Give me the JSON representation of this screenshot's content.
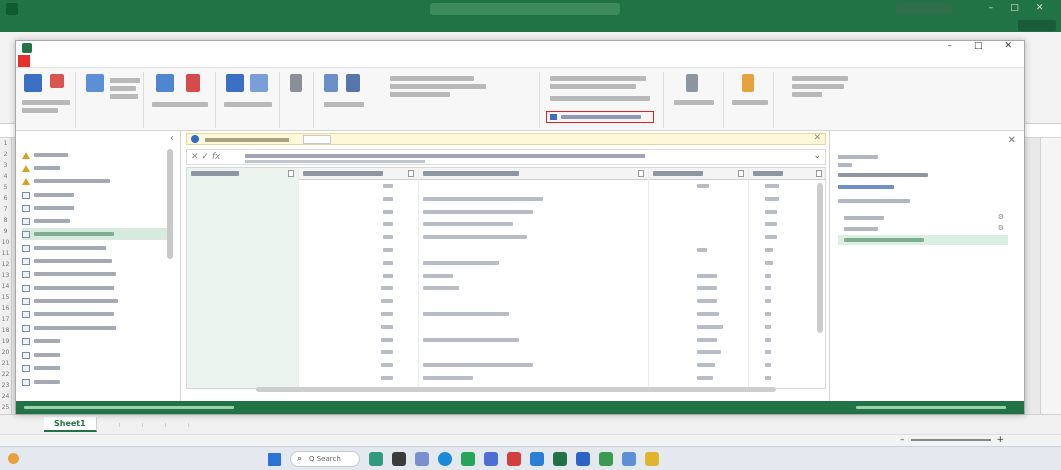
{
  "excel": {
    "title_text": "",
    "share_label": "",
    "menu": [],
    "sheet_tabs": [
      {
        "label": "Sheet1",
        "active": true
      },
      {
        "label": "",
        "active": false
      },
      {
        "label": "",
        "active": false
      },
      {
        "label": "",
        "active": false
      },
      {
        "label": "",
        "active": false
      }
    ],
    "status_text": ""
  },
  "power_query": {
    "window_title": "",
    "tabs": [
      {
        "label": "",
        "file": true
      },
      {
        "label": ""
      },
      {
        "label": ""
      },
      {
        "label": ""
      },
      {
        "label": ""
      }
    ],
    "queries_header": "",
    "settings_title": "",
    "highlighted_command": ""
  },
  "taskbar": {
    "search_label": "Q Search",
    "clock_time": "",
    "clock_date": ""
  },
  "colors": {
    "excel_green": "#217346",
    "file_tab_red": "#e8302b",
    "highlight_red": "#d9262b",
    "selected_row": "#d6ebde"
  },
  "icons": [
    "excel-logo-icon",
    "search-icon",
    "close-icon",
    "minimize-icon",
    "maximize-icon",
    "info-icon",
    "gear-icon",
    "warning-icon",
    "table-icon",
    "windows-start-icon"
  ]
}
